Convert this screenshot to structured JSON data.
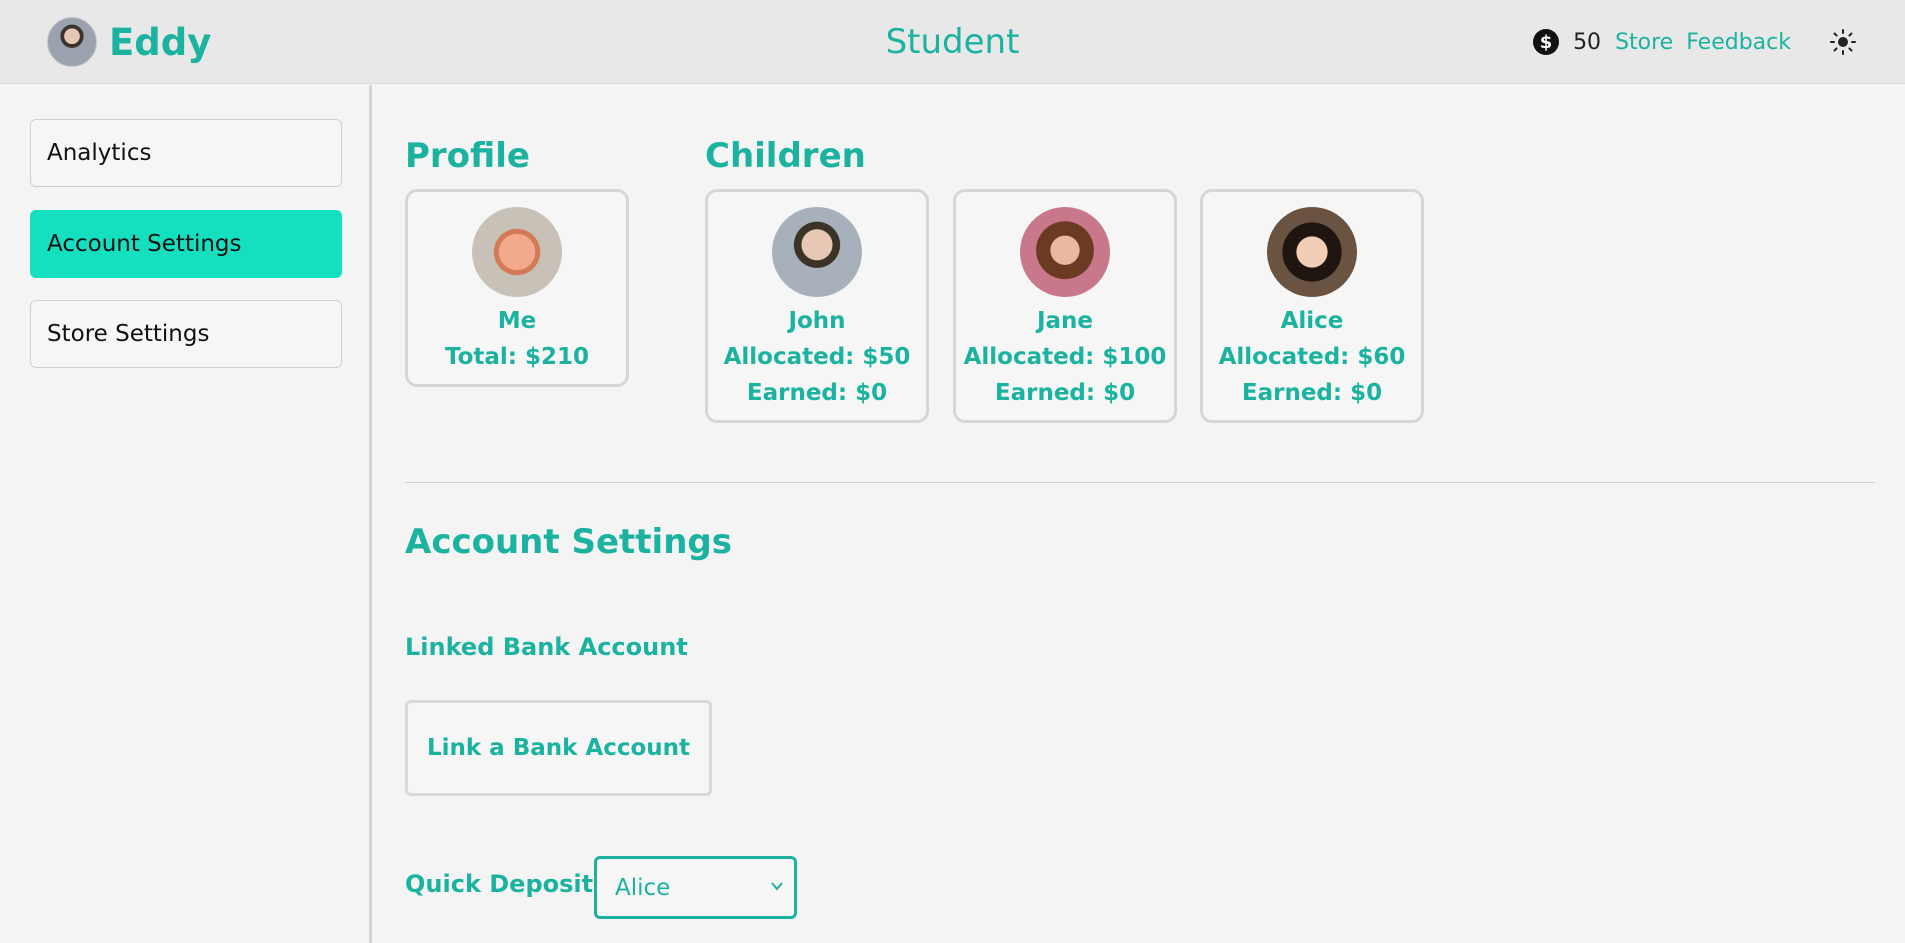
{
  "header": {
    "user_name": "Eddy",
    "page_title": "Student",
    "coins": "50",
    "coin_symbol": "$",
    "links": [
      "Store",
      "Feedback"
    ],
    "theme_icon": "sun-icon"
  },
  "sidebar": {
    "items": [
      {
        "label": "Analytics",
        "active": false
      },
      {
        "label": "Account Settings",
        "active": true
      },
      {
        "label": "Store Settings",
        "active": false
      }
    ]
  },
  "profile": {
    "heading": "Profile",
    "name": "Me",
    "total": "Total: $210"
  },
  "children": {
    "heading": "Children",
    "items": [
      {
        "name": "John",
        "allocated": "Allocated: $50",
        "earned": "Earned: $0"
      },
      {
        "name": "Jane",
        "allocated": "Allocated: $100",
        "earned": "Earned: $0"
      },
      {
        "name": "Alice",
        "allocated": "Allocated: $60",
        "earned": "Earned: $0"
      }
    ]
  },
  "account_settings": {
    "heading": "Account Settings",
    "linked_bank_heading": "Linked Bank Account",
    "link_button": "Link a Bank Account",
    "quick_deposit_label": "Quick Deposit",
    "quick_deposit_selected": "Alice"
  },
  "colors": {
    "accent": "#1bb3a0",
    "active_nav": "#14e0c0"
  }
}
